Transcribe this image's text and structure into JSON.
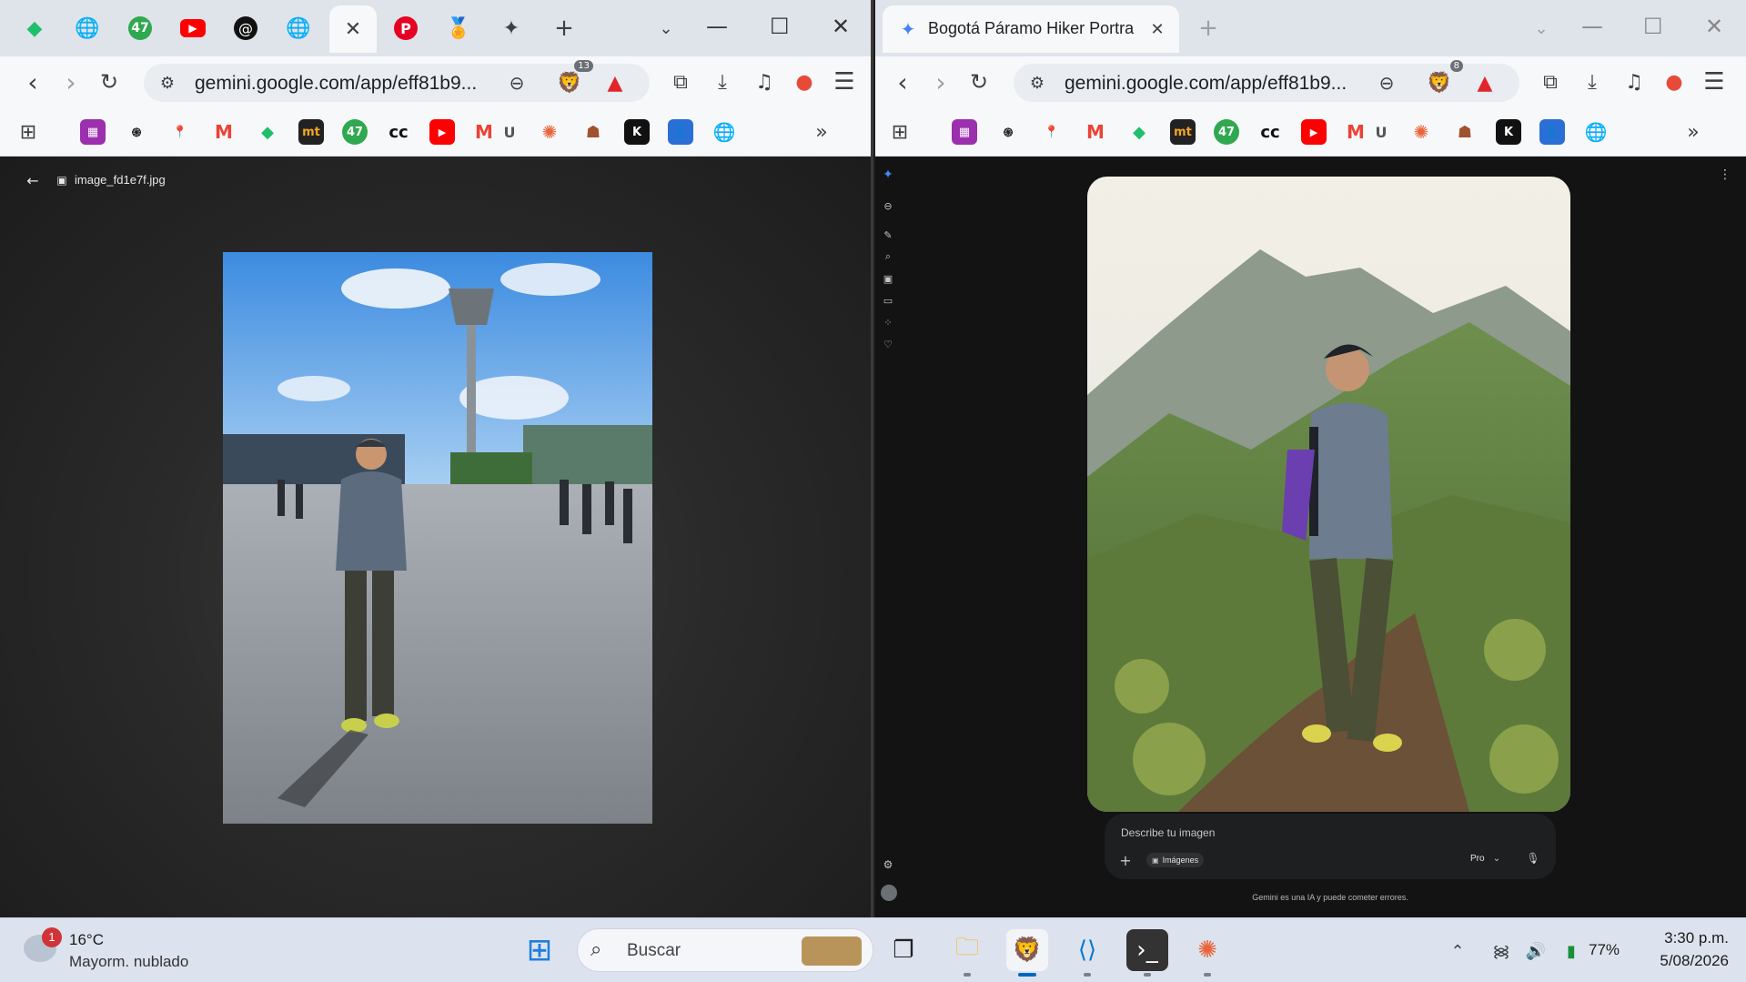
{
  "left_window": {
    "url": "gemini.google.com/app/eff81b9...",
    "viewer": {
      "back_label": "←",
      "filename": "image_fd1e7f.jpg"
    },
    "brave_badge": "13"
  },
  "right_window": {
    "tab_title": "Bogotá Páramo Hiker Portrait - G",
    "url": "gemini.google.com/app/eff81b9...",
    "brave_badge": "8",
    "composer": {
      "placeholder": "Describe tu imagen",
      "images_chip": "Imágenes",
      "model": "Pro",
      "disclaimer": "Gemini es una IA y puede cometer errores."
    }
  },
  "bookmarks": {
    "u_label": "U",
    "mt_label": "mt",
    "k_label": "K",
    "n47_label": "47"
  },
  "tabs_left": {
    "n47_label": "47"
  },
  "taskbar": {
    "weather_temp": "16°C",
    "weather_desc": "Mayorm. nublado",
    "weather_badge": "1",
    "search_placeholder": "Buscar",
    "battery": "77%",
    "time": "3:30 p.m.",
    "date": "5/08/2026"
  },
  "colors": {
    "accent_brave": "#fb542b",
    "vscode": "#0078d4",
    "gemini": "#4285f4"
  }
}
